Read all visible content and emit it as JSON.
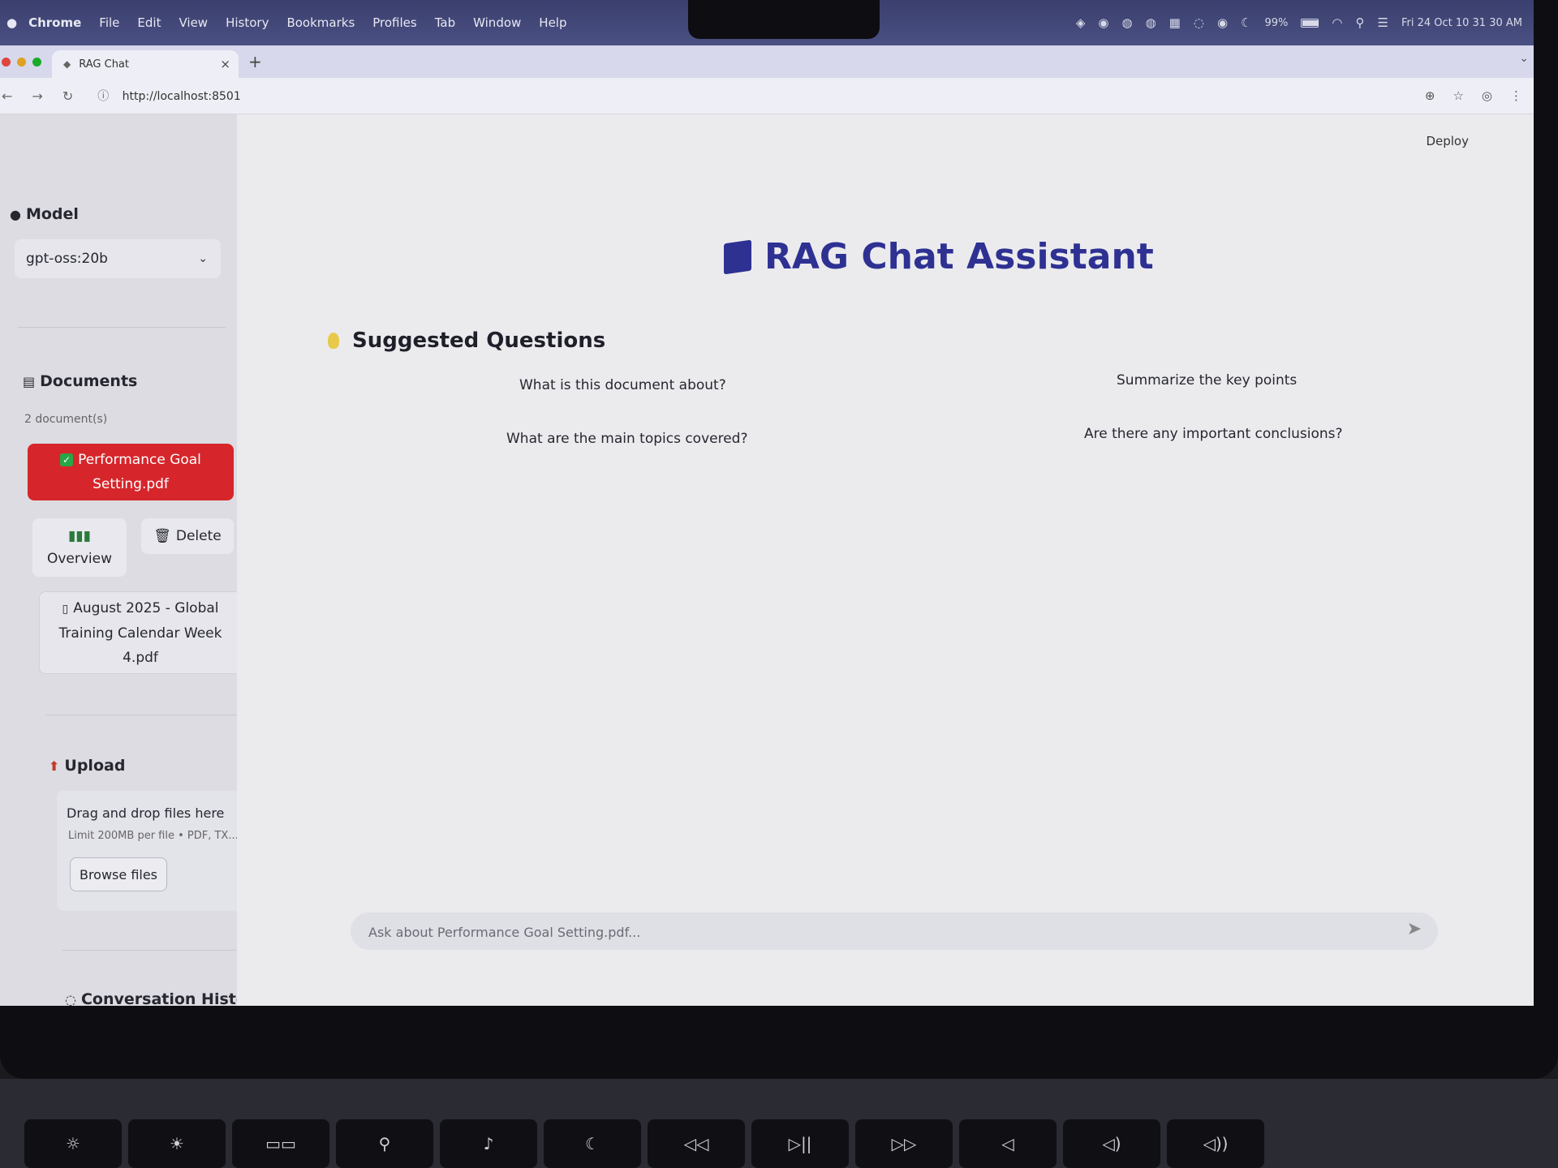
{
  "menubar": {
    "app": "Chrome",
    "items": [
      "File",
      "Edit",
      "View",
      "History",
      "Bookmarks",
      "Profiles",
      "Tab",
      "Window",
      "Help"
    ],
    "battery": "99%",
    "battery_level": 0.99,
    "clock": "Fri 24 Oct  10 31 30 AM"
  },
  "browser": {
    "tab_title": "RAG Chat",
    "url": "http://localhost:8501"
  },
  "header": {
    "deploy": "Deploy"
  },
  "sidebar": {
    "model_title": "Model",
    "model_value": "gpt-oss:20b",
    "documents_title": "Documents",
    "documents_count": "2 document(s)",
    "active_doc_line1": "Performance Goal",
    "active_doc_line2": "Setting.pdf",
    "overview_label": "Overview",
    "delete_label": "Delete",
    "doc2_line1": "August 2025 - Global",
    "doc2_line2": "Training Calendar Week",
    "doc2_line3": "4.pdf",
    "upload_title": "Upload",
    "drag_text": "Drag and drop files here",
    "limit_text": "Limit 200MB per file • PDF, TX...",
    "browse_label": "Browse files",
    "history_title": "Conversation History"
  },
  "main": {
    "title": "RAG Chat Assistant",
    "suggested_title": "Suggested Questions",
    "questions": [
      "What is this document about?",
      "Summarize the key points",
      "What are the main topics covered?",
      "Are there any important conclusions?"
    ],
    "chat_placeholder": "Ask about Performance Goal Setting.pdf..."
  },
  "colors": {
    "accent": "#2e3192",
    "active_doc": "#d6262b",
    "menubar": "#3a3f6e"
  },
  "icons": [
    "model-icon",
    "books-icon",
    "check-icon",
    "chart-icon",
    "trash-icon",
    "file-icon",
    "upload-icon",
    "book-icon",
    "bulb-icon",
    "chat-bubble-icon",
    "send-icon"
  ]
}
